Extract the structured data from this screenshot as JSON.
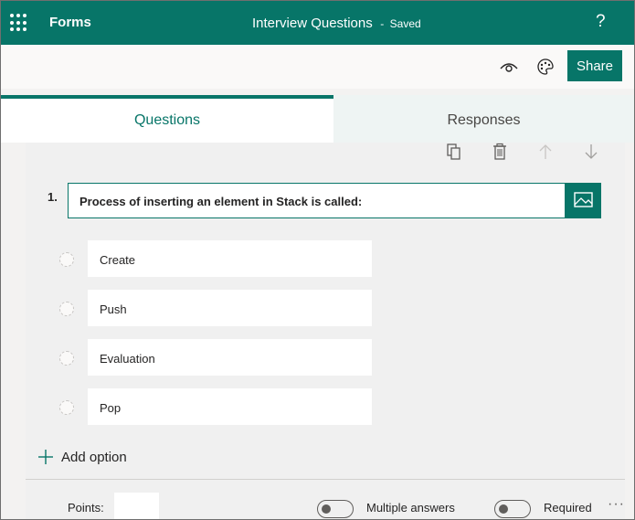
{
  "header": {
    "app_name": "Forms",
    "title": "Interview Questions",
    "separator": "-",
    "status": "Saved",
    "help_label": "?"
  },
  "toolbar": {
    "preview_icon": "eye-icon",
    "theme_icon": "palette-icon",
    "share_label": "Share"
  },
  "tabs": [
    {
      "label": "Questions",
      "active": true
    },
    {
      "label": "Responses",
      "active": false
    }
  ],
  "question": {
    "number": "1.",
    "text": "Process of inserting an element in Stack is called:",
    "actions": [
      "copy-icon",
      "delete-icon",
      "move-up-icon",
      "move-down-icon"
    ],
    "options": [
      {
        "label": "Create"
      },
      {
        "label": "Push"
      },
      {
        "label": "Evaluation"
      },
      {
        "label": "Pop"
      }
    ],
    "add_option_label": "Add option",
    "points_label": "Points:",
    "points_value": "",
    "multiple_answers_label": "Multiple answers",
    "multiple_answers_on": false,
    "required_label": "Required",
    "required_on": false,
    "more_label": "···"
  },
  "colors": {
    "brand": "#077568",
    "tab_inactive_bg": "#eef4f3"
  }
}
